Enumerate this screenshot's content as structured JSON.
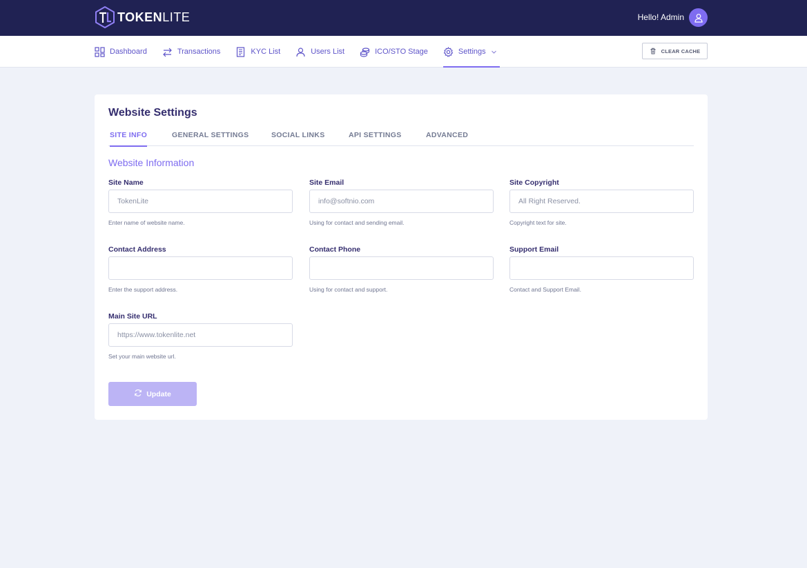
{
  "header": {
    "logo_bold": "TOKEN",
    "logo_light": "LITE",
    "greeting": "Hello! Admin"
  },
  "nav": {
    "items": [
      {
        "label": "Dashboard",
        "icon": "dashboard-icon"
      },
      {
        "label": "Transactions",
        "icon": "transfer-arrows-icon"
      },
      {
        "label": "KYC List",
        "icon": "document-list-icon"
      },
      {
        "label": "Users List",
        "icon": "user-icon"
      },
      {
        "label": "ICO/STO Stage",
        "icon": "coins-icon"
      },
      {
        "label": "Settings",
        "icon": "gear-icon",
        "active": true
      }
    ],
    "clear_cache": "CLEAR CACHE"
  },
  "card": {
    "title": "Website Settings",
    "tabs": [
      "SITE INFO",
      "GENERAL SETTINGS",
      "SOCIAL LINKS",
      "API SETTINGS",
      "ADVANCED"
    ],
    "active_tab": "SITE INFO",
    "section_title": "Website Information",
    "fields": [
      {
        "label": "Site Name",
        "value": "TokenLite",
        "hint": "Enter name of website name."
      },
      {
        "label": "Site Email",
        "value": "info@softnio.com",
        "hint": "Using for contact and sending email."
      },
      {
        "label": "Site Copyright",
        "value": "All Right Reserved.",
        "hint": "Copyright text for site."
      },
      {
        "label": "Contact Address",
        "value": "",
        "hint": "Enter the support address."
      },
      {
        "label": "Contact Phone",
        "value": "",
        "hint": "Using for contact and support."
      },
      {
        "label": "Support Email",
        "value": "",
        "hint": "Contact and Support Email."
      },
      {
        "label": "Main Site URL",
        "value": "https://www.tokenlite.net",
        "hint": "Set your main website url."
      }
    ],
    "update_label": "Update"
  },
  "colors": {
    "topbar": "#202253",
    "accent": "#7e6cf0",
    "nav_text": "#5e54c9",
    "background": "#eff2f9",
    "button_disabled": "#bcb4f5"
  }
}
